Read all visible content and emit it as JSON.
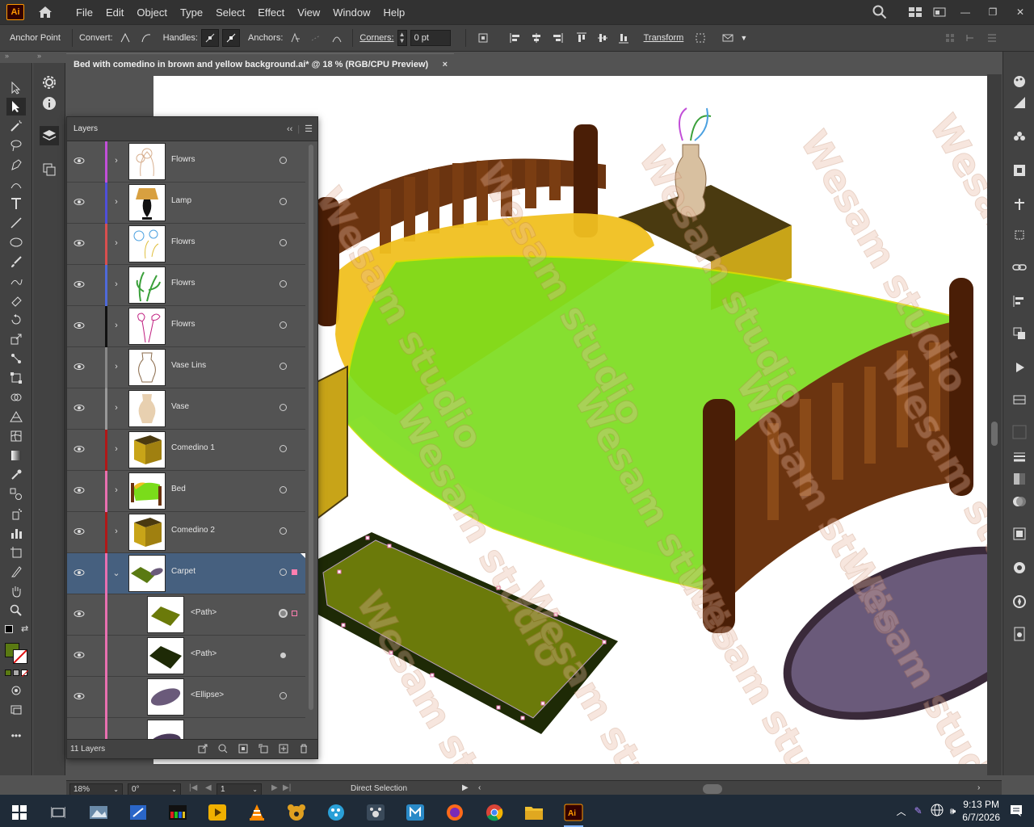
{
  "app": {
    "logo_text": "Ai",
    "menu": [
      "File",
      "Edit",
      "Object",
      "Type",
      "Select",
      "Effect",
      "View",
      "Window",
      "Help"
    ]
  },
  "control_bar": {
    "tool_label": "Anchor Point",
    "convert_label": "Convert:",
    "handles_label": "Handles:",
    "anchors_label": "Anchors:",
    "corners_label": "Corners:",
    "corners_value": "0 pt",
    "transform_label": "Transform"
  },
  "document": {
    "tab_title": "Bed with comedino in brown and yellow background.ai* @ 18 % (RGB/CPU Preview)",
    "close_symbol": "×"
  },
  "layers_panel": {
    "title": "Layers",
    "count_label": "11 Layers",
    "rows": [
      {
        "name": "Flowrs",
        "color": "#c24fd8",
        "thumb": "flowers-sketch-icon",
        "expanded": false
      },
      {
        "name": "Lamp",
        "color": "#4f4fd8",
        "thumb": "lamp-icon",
        "expanded": false
      },
      {
        "name": "Flowrs",
        "color": "#d84f4f",
        "thumb": "flowers-blue-icon",
        "expanded": false
      },
      {
        "name": "Flowrs",
        "color": "#4f6ad8",
        "thumb": "flowers-green-icon",
        "expanded": false
      },
      {
        "name": "Flowrs",
        "color": "#111111",
        "thumb": "flowers-magenta-icon",
        "expanded": false
      },
      {
        "name": "Vase Lins",
        "color": "#888888",
        "thumb": "vase-lines-icon",
        "expanded": false
      },
      {
        "name": "Vase",
        "color": "#999999",
        "thumb": "vase-icon",
        "expanded": false
      },
      {
        "name": "Comedino 1",
        "color": "#b01818",
        "thumb": "nightstand-icon",
        "expanded": false
      },
      {
        "name": "Bed",
        "color": "#e870b0",
        "thumb": "bed-icon",
        "expanded": false
      },
      {
        "name": "Comedino 2",
        "color": "#b01818",
        "thumb": "nightstand-icon",
        "expanded": false
      },
      {
        "name": "Carpet",
        "color": "#e870b0",
        "thumb": "carpet-icon",
        "expanded": true
      }
    ],
    "sublayers": [
      {
        "name": "<Path>",
        "thumb": "path-olive-icon"
      },
      {
        "name": "<Path>",
        "thumb": "path-dark-icon"
      },
      {
        "name": "<Ellipse>",
        "thumb": "ellipse-icon"
      }
    ]
  },
  "status_bar": {
    "zoom": "18%",
    "rotation": "0°",
    "artboard": "1",
    "tool": "Direct Selection"
  },
  "artwork": {
    "watermark": "Wesam studio"
  },
  "taskbar": {
    "time": "9:13 PM",
    "date": "6/7/2026",
    "apps": [
      "windows-start-icon",
      "task-view-icon",
      "photos-icon",
      "snipping-icon",
      "video-studio-icon",
      "player-icon",
      "vlc-icon",
      "gom-icon",
      "paint3d-icon",
      "paw-icon",
      "app-m-icon",
      "firefox-icon",
      "chrome-icon",
      "file-explorer-icon",
      "illustrator-icon"
    ]
  },
  "colors": {
    "ui_dark": "#323232",
    "panel": "#535353",
    "selection": "#46607f",
    "fill_swatch": "#5a7a12",
    "ai_orange": "#ff9a00"
  }
}
